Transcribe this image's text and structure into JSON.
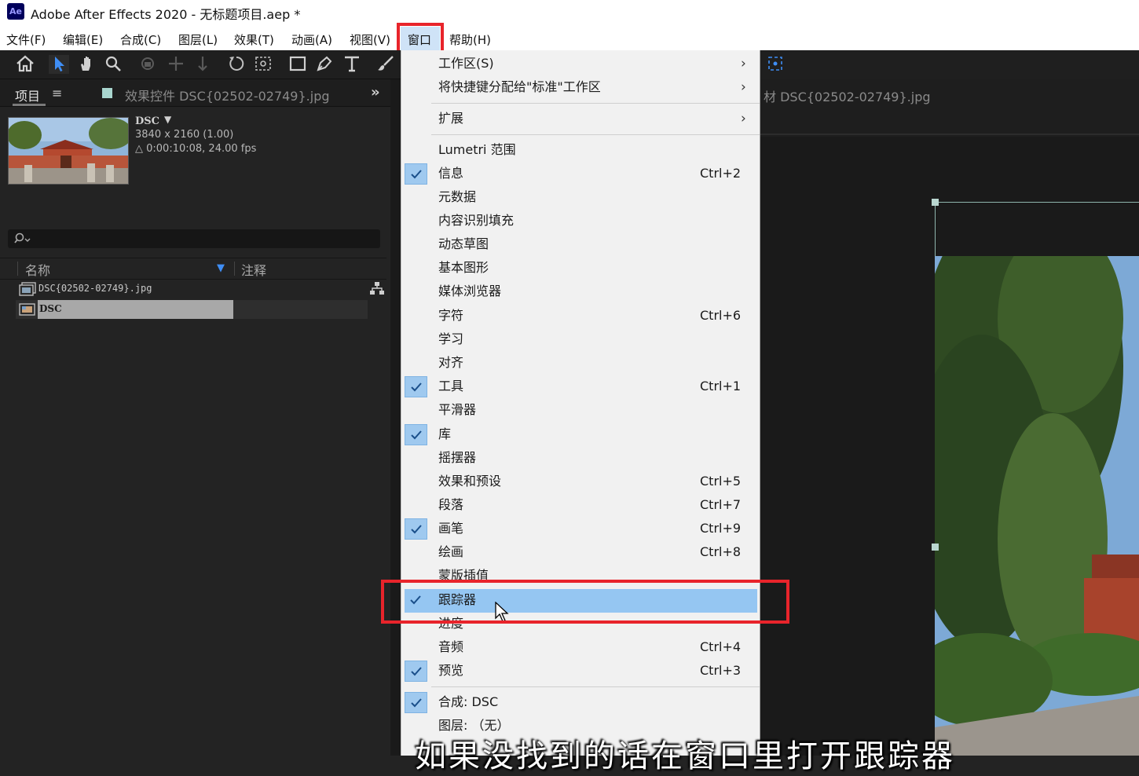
{
  "window": {
    "title": "Adobe After Effects 2020 - 无标题项目.aep *",
    "logo_text": "Ae"
  },
  "menubar": {
    "items": [
      "文件(F)",
      "编辑(E)",
      "合成(C)",
      "图层(L)",
      "效果(T)",
      "动画(A)",
      "视图(V)",
      "窗口",
      "帮助(H)"
    ],
    "active": "窗口"
  },
  "toolbar": {
    "tools": [
      "home-icon",
      "selection-arrow-icon",
      "hand-icon",
      "zoom-icon",
      "orbit-camera-icon",
      "pan-camera-icon",
      "dolly-camera-icon",
      "rotate-icon",
      "anchor-point-icon",
      "rectangle-icon",
      "pen-icon",
      "type-icon",
      "brush-icon"
    ]
  },
  "project_panel": {
    "tab_project": "项目",
    "tab_effects": "效果控件 DSC{02502-02749}.jpg",
    "tab_overflow": "»",
    "item_name": "DSC",
    "item_dims": "3840 x 2160 (1.00)",
    "item_duration": "△ 0:00:10:08, 24.00 fps",
    "search_placeholder": "",
    "col_name": "名称",
    "col_comment": "注释",
    "rows": [
      {
        "name": "DSC{02502-02749}.jpg",
        "type": "footage",
        "selected": false
      },
      {
        "name": "DSC",
        "type": "composition",
        "selected": true
      }
    ]
  },
  "right_panel": {
    "tab_text": "材 DSC{02502-02749}.jpg"
  },
  "window_menu": {
    "items": [
      {
        "label": "工作区(S)",
        "shortcut": "",
        "checked": false,
        "submenu": true
      },
      {
        "label": "将快捷键分配给\"标准\"工作区",
        "shortcut": "",
        "checked": false,
        "submenu": true
      },
      {
        "sep": true
      },
      {
        "label": "扩展",
        "shortcut": "",
        "checked": false,
        "submenu": true
      },
      {
        "sep": true
      },
      {
        "label": "Lumetri 范围",
        "shortcut": "",
        "checked": false
      },
      {
        "label": "信息",
        "shortcut": "Ctrl+2",
        "checked": true
      },
      {
        "label": "元数据",
        "shortcut": "",
        "checked": false
      },
      {
        "label": "内容识别填充",
        "shortcut": "",
        "checked": false
      },
      {
        "label": "动态草图",
        "shortcut": "",
        "checked": false
      },
      {
        "label": "基本图形",
        "shortcut": "",
        "checked": false
      },
      {
        "label": "媒体浏览器",
        "shortcut": "",
        "checked": false
      },
      {
        "label": "字符",
        "shortcut": "Ctrl+6",
        "checked": false
      },
      {
        "label": "学习",
        "shortcut": "",
        "checked": false
      },
      {
        "label": "对齐",
        "shortcut": "",
        "checked": false
      },
      {
        "label": "工具",
        "shortcut": "Ctrl+1",
        "checked": true
      },
      {
        "label": "平滑器",
        "shortcut": "",
        "checked": false
      },
      {
        "label": "库",
        "shortcut": "",
        "checked": true
      },
      {
        "label": "摇摆器",
        "shortcut": "",
        "checked": false
      },
      {
        "label": "效果和预设",
        "shortcut": "Ctrl+5",
        "checked": false
      },
      {
        "label": "段落",
        "shortcut": "Ctrl+7",
        "checked": false
      },
      {
        "label": "画笔",
        "shortcut": "Ctrl+9",
        "checked": true
      },
      {
        "label": "绘画",
        "shortcut": "Ctrl+8",
        "checked": false
      },
      {
        "label": "蒙版插值",
        "shortcut": "",
        "checked": false
      },
      {
        "label": "跟踪器",
        "shortcut": "",
        "checked": true,
        "highlighted": true
      },
      {
        "label": "进度",
        "shortcut": "",
        "checked": false
      },
      {
        "label": "音频",
        "shortcut": "Ctrl+4",
        "checked": false
      },
      {
        "label": "预览",
        "shortcut": "Ctrl+3",
        "checked": true
      },
      {
        "sep": true
      },
      {
        "label": "合成: DSC",
        "shortcut": "",
        "checked": true
      },
      {
        "label": "图层: （无）",
        "shortcut": "",
        "checked": false
      }
    ]
  },
  "subtitle": "如果没找到的话在窗口里打开跟踪器",
  "colors": {
    "highlight": "#95c6f2",
    "check_bg": "#9fc9ef",
    "annotation_red": "#e8242b",
    "panel_bg": "#232323"
  }
}
